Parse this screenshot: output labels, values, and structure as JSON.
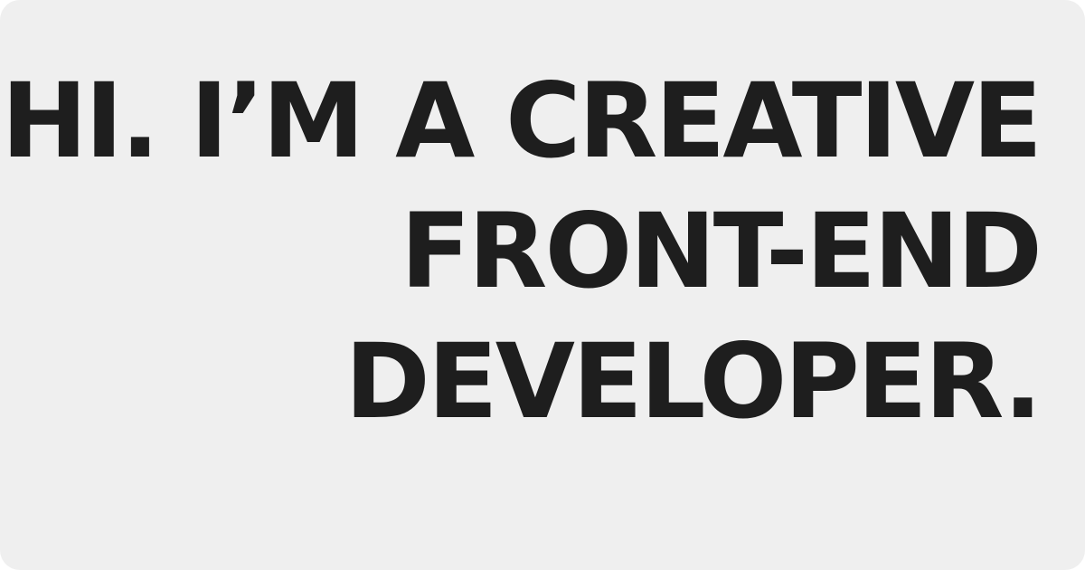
{
  "hero": {
    "lines": [
      "HI. I’M A CREATIVE",
      "FRONT-END",
      "DEVELOPER."
    ],
    "text_color": "#1e1e1e",
    "background_color": "#efefef"
  }
}
